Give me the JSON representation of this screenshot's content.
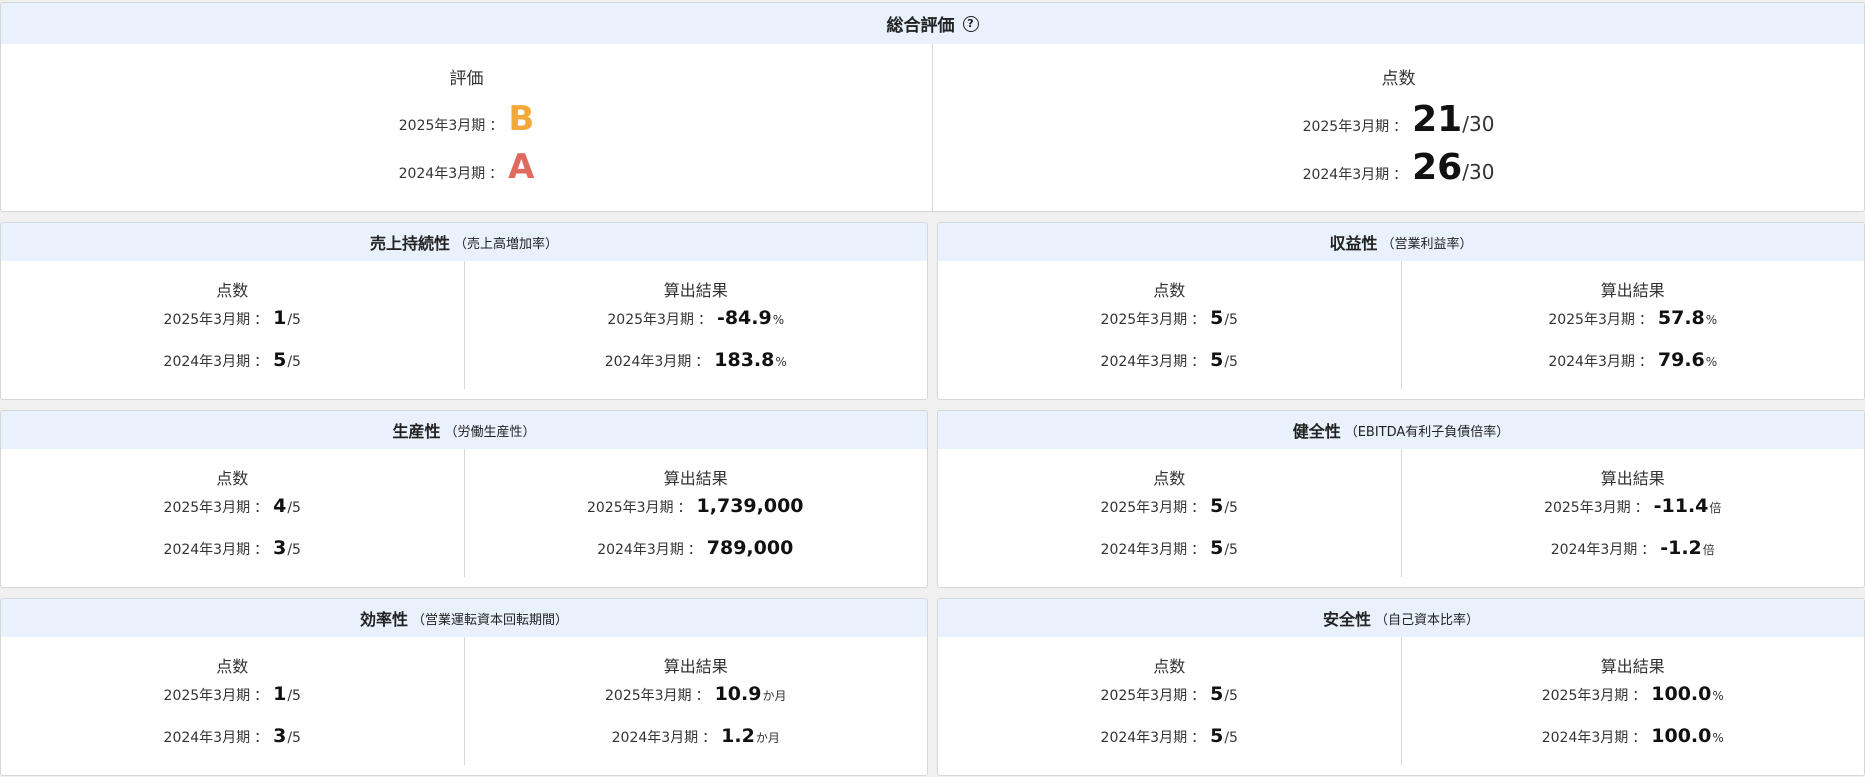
{
  "overall": {
    "title": "総合評価",
    "help_icon": "?",
    "grade_title": "評価",
    "score_title": "点数",
    "grades": [
      {
        "period": "2025年3月期",
        "grade": "B",
        "color": "#f3a93a"
      },
      {
        "period": "2024年3月期",
        "grade": "A",
        "color": "#e06a5e"
      }
    ],
    "scores": [
      {
        "period": "2025年3月期",
        "score": "21",
        "max": "/30"
      },
      {
        "period": "2024年3月期",
        "score": "26",
        "max": "/30"
      }
    ]
  },
  "labels": {
    "score": "点数",
    "result": "算出結果",
    "sep": "："
  },
  "metrics": [
    {
      "title": "売上持続性",
      "subtitle": "（売上高増加率）",
      "scores": [
        {
          "period": "2025年3月期",
          "score": "1",
          "max": "/5"
        },
        {
          "period": "2024年3月期",
          "score": "5",
          "max": "/5"
        }
      ],
      "results": [
        {
          "period": "2025年3月期",
          "value": "-84.9",
          "unit": "%"
        },
        {
          "period": "2024年3月期",
          "value": "183.8",
          "unit": "%"
        }
      ]
    },
    {
      "title": "収益性",
      "subtitle": "（営業利益率）",
      "scores": [
        {
          "period": "2025年3月期",
          "score": "5",
          "max": "/5"
        },
        {
          "period": "2024年3月期",
          "score": "5",
          "max": "/5"
        }
      ],
      "results": [
        {
          "period": "2025年3月期",
          "value": "57.8",
          "unit": "%"
        },
        {
          "period": "2024年3月期",
          "value": "79.6",
          "unit": "%"
        }
      ]
    },
    {
      "title": "生産性",
      "subtitle": "（労働生産性）",
      "scores": [
        {
          "period": "2025年3月期",
          "score": "4",
          "max": "/5"
        },
        {
          "period": "2024年3月期",
          "score": "3",
          "max": "/5"
        }
      ],
      "results": [
        {
          "period": "2025年3月期",
          "value": "1,739,000",
          "unit": ""
        },
        {
          "period": "2024年3月期",
          "value": "789,000",
          "unit": ""
        }
      ]
    },
    {
      "title": "健全性",
      "subtitle": "（EBITDA有利子負債倍率）",
      "scores": [
        {
          "period": "2025年3月期",
          "score": "5",
          "max": "/5"
        },
        {
          "period": "2024年3月期",
          "score": "5",
          "max": "/5"
        }
      ],
      "results": [
        {
          "period": "2025年3月期",
          "value": "-11.4",
          "unit": "倍"
        },
        {
          "period": "2024年3月期",
          "value": "-1.2",
          "unit": "倍"
        }
      ]
    },
    {
      "title": "効率性",
      "subtitle": "（営業運転資本回転期間）",
      "scores": [
        {
          "period": "2025年3月期",
          "score": "1",
          "max": "/5"
        },
        {
          "period": "2024年3月期",
          "score": "3",
          "max": "/5"
        }
      ],
      "results": [
        {
          "period": "2025年3月期",
          "value": "10.9",
          "unit": "か月"
        },
        {
          "period": "2024年3月期",
          "value": "1.2",
          "unit": "か月"
        }
      ]
    },
    {
      "title": "安全性",
      "subtitle": "（自己資本比率）",
      "scores": [
        {
          "period": "2025年3月期",
          "score": "5",
          "max": "/5"
        },
        {
          "period": "2024年3月期",
          "score": "5",
          "max": "/5"
        }
      ],
      "results": [
        {
          "period": "2025年3月期",
          "value": "100.0",
          "unit": "%"
        },
        {
          "period": "2024年3月期",
          "value": "100.0",
          "unit": "%"
        }
      ]
    }
  ]
}
